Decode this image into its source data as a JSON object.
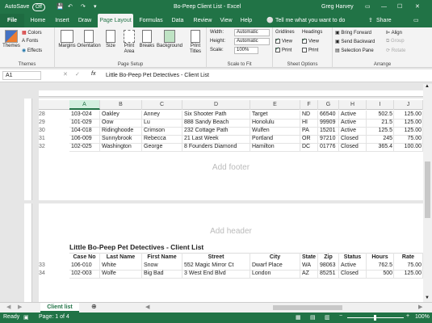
{
  "titlebar": {
    "autosave": "AutoSave",
    "autosave_state": "Off",
    "doc_title": "Bo-Peep Client List - Excel",
    "user": "Greg Harvey"
  },
  "tabs": [
    "File",
    "Home",
    "Insert",
    "Draw",
    "Page Layout",
    "Formulas",
    "Data",
    "Review",
    "View",
    "Help"
  ],
  "tell_me": "Tell me what you want to do",
  "share": "Share",
  "ribbon": {
    "themes": {
      "themes": "Themes",
      "colors": "Colors",
      "fonts": "Fonts",
      "effects": "Effects",
      "label": "Themes"
    },
    "page_setup": {
      "margins": "Margins",
      "orientation": "Orientation",
      "size": "Size",
      "print_area": "Print Area",
      "breaks": "Breaks",
      "background": "Background",
      "print_titles": "Print Titles",
      "label": "Page Setup"
    },
    "scale": {
      "width": "Width:",
      "width_val": "Automatic",
      "height": "Height:",
      "height_val": "Automatic",
      "scale": "Scale:",
      "scale_val": "100%",
      "label": "Scale to Fit"
    },
    "sheet_options": {
      "gridlines": "Gridlines",
      "headings": "Headings",
      "view": "View",
      "print": "Print",
      "label": "Sheet Options"
    },
    "arrange": {
      "bring_forward": "Bring Forward",
      "send_backward": "Send Backward",
      "selection_pane": "Selection Pane",
      "align": "Align",
      "group": "Group",
      "rotate": "Rotate",
      "label": "Arrange"
    }
  },
  "formula_bar": {
    "namebox": "A1",
    "fx": "fx",
    "content": "Little Bo-Peep Pet Detectives - Client List"
  },
  "columns": [
    "A",
    "B",
    "C",
    "D",
    "E",
    "F",
    "G",
    "H",
    "I",
    "J"
  ],
  "page1_rows": [
    {
      "n": "28",
      "cells": [
        "103-024",
        "Oakley",
        "Anney",
        "Six Shooter Path",
        "Target",
        "ND",
        "66540",
        "Active",
        "502.5",
        "125.00"
      ]
    },
    {
      "n": "29",
      "cells": [
        "101-029",
        "Oow",
        "Lu",
        "888 Sandy Beach",
        "Honolulu",
        "HI",
        "99909",
        "Active",
        "21.5",
        "125.00"
      ]
    },
    {
      "n": "30",
      "cells": [
        "104-018",
        "Ridinghoode",
        "Crimson",
        "232 Cottage Path",
        "Wulfen",
        "PA",
        "15201",
        "Active",
        "125.5",
        "125.00"
      ]
    },
    {
      "n": "31",
      "cells": [
        "106-009",
        "Sunnybrook",
        "Rebecca",
        "21 Last Week",
        "Portland",
        "OR",
        "97210",
        "Closed",
        "245",
        "75.00"
      ]
    },
    {
      "n": "32",
      "cells": [
        "102-025",
        "Washington",
        "George",
        "8 Founders Diamond",
        "Hamilton",
        "DC",
        "01776",
        "Closed",
        "365.4",
        "100.00"
      ]
    }
  ],
  "add_footer": "Add footer",
  "add_header": "Add header",
  "print_title": "Little Bo-Peep Pet Detectives - Client List",
  "print_headers": [
    "Case No",
    "Last Name",
    "First Name",
    "Street",
    "City",
    "State",
    "Zip",
    "Status",
    "Hours",
    "Rate"
  ],
  "page2_rows": [
    {
      "n": "33",
      "cells": [
        "106-010",
        "White",
        "Snow",
        "552 Magic Mirror Ct",
        "Dwarf Place",
        "WA",
        "98063",
        "Active",
        "762.5",
        "75.00"
      ]
    },
    {
      "n": "34",
      "cells": [
        "102-003",
        "Wolfe",
        "Big Bad",
        "3 West End Blvd",
        "London",
        "AZ",
        "85251",
        "Closed",
        "500",
        "125.00"
      ]
    }
  ],
  "sheet_tab": "Client list",
  "status": {
    "ready": "Ready",
    "page": "Page: 1 of 4",
    "zoom": "100%"
  }
}
